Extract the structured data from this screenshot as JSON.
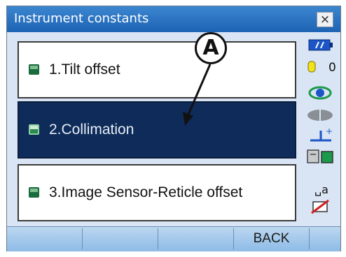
{
  "window": {
    "title": "Instrument constants",
    "close_label": "×"
  },
  "menu": [
    {
      "label": "1.Tilt offset",
      "selected": false
    },
    {
      "label": "2.Collimation",
      "selected": true
    },
    {
      "label": "3.Image Sensor-Reticle offset",
      "selected": false
    }
  ],
  "status": {
    "battery_icon": "battery-icon",
    "count_value": "0",
    "keyboard_text": "␣a"
  },
  "softkeys": [
    "",
    "",
    "",
    "BACK",
    ""
  ],
  "callout": {
    "label": "A"
  },
  "colors": {
    "titlebar": "#1d63b4",
    "selected": "#0e2b59",
    "softkey_bar": "#8dbbe6"
  }
}
